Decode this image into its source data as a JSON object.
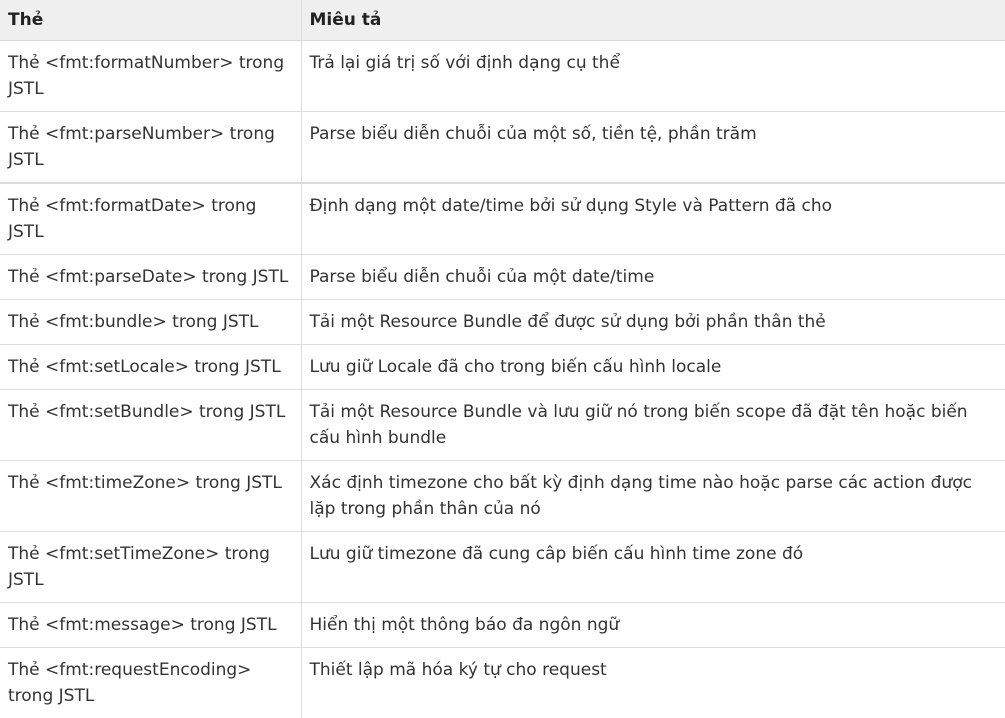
{
  "table": {
    "headers": [
      "Thẻ",
      "Miêu tả"
    ],
    "rows": [
      {
        "tag": "Thẻ <fmt:formatNumber> trong JSTL",
        "description": "Trả lại giá trị số với định dạng cụ thể"
      },
      {
        "tag": "Thẻ <fmt:parseNumber> trong JSTL",
        "description": "Parse biểu diễn chuỗi của một số, tiền tệ, phần trăm"
      },
      {
        "tag": "Thẻ <fmt:formatDate> trong JSTL",
        "description": "Định dạng một date/time bởi sử dụng Style và Pattern đã cho"
      },
      {
        "tag": "Thẻ <fmt:parseDate> trong JSTL",
        "description": "Parse biểu diễn chuỗi của một date/time"
      },
      {
        "tag": "Thẻ <fmt:bundle> trong JSTL",
        "description": "Tải một Resource Bundle để được sử dụng bởi phần thân thẻ"
      },
      {
        "tag": "Thẻ <fmt:setLocale> trong JSTL",
        "description": "Lưu giữ Locale đã cho trong biến cấu hình locale"
      },
      {
        "tag": "Thẻ <fmt:setBundle> trong JSTL",
        "description": "Tải một Resource Bundle và lưu giữ nó trong biến scope đã đặt tên hoặc biến cấu hình bundle"
      },
      {
        "tag": "Thẻ <fmt:timeZone> trong JSTL",
        "description": "Xác định timezone cho bất kỳ định dạng time nào hoặc parse các action được lặp trong phần thân của nó"
      },
      {
        "tag": "Thẻ <fmt:setTimeZone> trong JSTL",
        "description": "Lưu giữ timezone đã cung câp biến cấu hình time zone đó"
      },
      {
        "tag": "Thẻ <fmt:message> trong JSTL",
        "description": "Hiển thị một thông báo đa ngôn ngữ"
      },
      {
        "tag": "Thẻ <fmt:requestEncoding> trong JSTL",
        "description": "Thiết lập mã hóa ký tự cho request"
      }
    ]
  }
}
